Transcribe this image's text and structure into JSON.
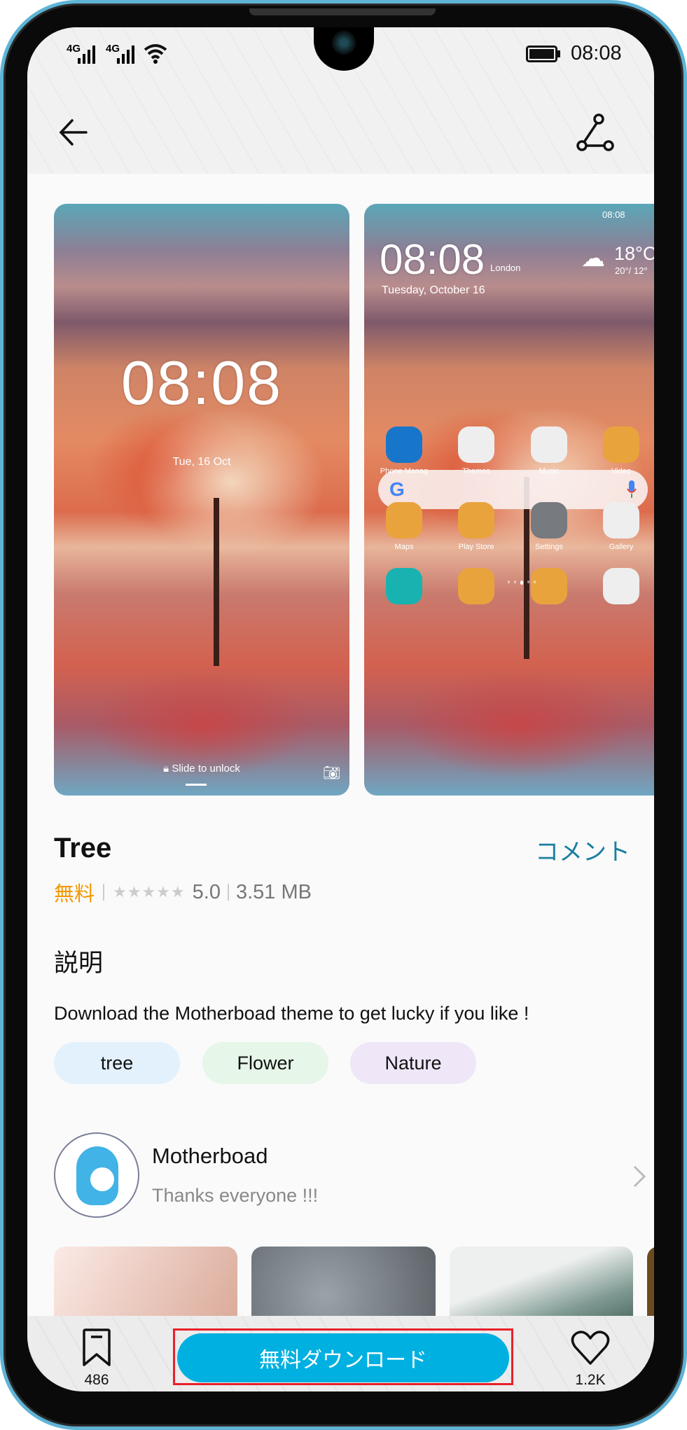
{
  "status_bar": {
    "network_1": "4G",
    "network_2": "4G",
    "time": "08:08",
    "icons": [
      "signal-icon",
      "signal-icon",
      "wifi-icon",
      "battery-icon"
    ]
  },
  "header": {
    "back_icon": "arrow-left-icon",
    "share_icon": "share-icon"
  },
  "previews": {
    "lockscreen": {
      "time": "08:08",
      "date": "Tue, 16 Oct",
      "unlock_text": "Slide to unlock"
    },
    "homescreen": {
      "status_time": "08:08",
      "time": "08:08",
      "city": "London",
      "date": "Tuesday, October 16",
      "temperature": "18°C",
      "temp_range": "20°/ 12°",
      "apps": [
        {
          "label": "Phone Manag",
          "color": "#1776c9"
        },
        {
          "label": "Themes",
          "color": "#eeeeee"
        },
        {
          "label": "Music",
          "color": "#eeeeee"
        },
        {
          "label": "Video",
          "color": "#e9a33d"
        },
        {
          "label": "Maps",
          "color": "#e9a33d"
        },
        {
          "label": "Play Store",
          "color": "#e9a33d"
        },
        {
          "label": "Settings",
          "color": "#777a7e"
        },
        {
          "label": "Gallery",
          "color": "#eeeeee"
        },
        {
          "label": "",
          "color": "#18b3b0"
        },
        {
          "label": "",
          "color": "#e9a33d"
        },
        {
          "label": "",
          "color": "#e9a33d"
        },
        {
          "label": "",
          "color": "#eeeeee"
        }
      ]
    }
  },
  "theme": {
    "title": "Tree",
    "comment_link": "コメント",
    "price": "無料",
    "rating": "5.0",
    "stars": 5,
    "size": "3.51 MB"
  },
  "description": {
    "heading": "説明",
    "text": "Download the Motherboad theme to get lucky if you like !"
  },
  "tags": [
    {
      "label": "tree",
      "color": "#e3f1fd"
    },
    {
      "label": "Flower",
      "color": "#e6f6e8"
    },
    {
      "label": "Nature",
      "color": "#efe6f8"
    }
  ],
  "author": {
    "name": "Motherboad",
    "subtitle": "Thanks everyone !!!"
  },
  "bottom_bar": {
    "bookmark_count": "486",
    "download_label": "無料ダウンロード",
    "like_count": "1.2K"
  },
  "colors": {
    "accent": "#00b0e0",
    "price": "#f39800",
    "link": "#1a7fa0",
    "highlight": "#e8202a"
  }
}
